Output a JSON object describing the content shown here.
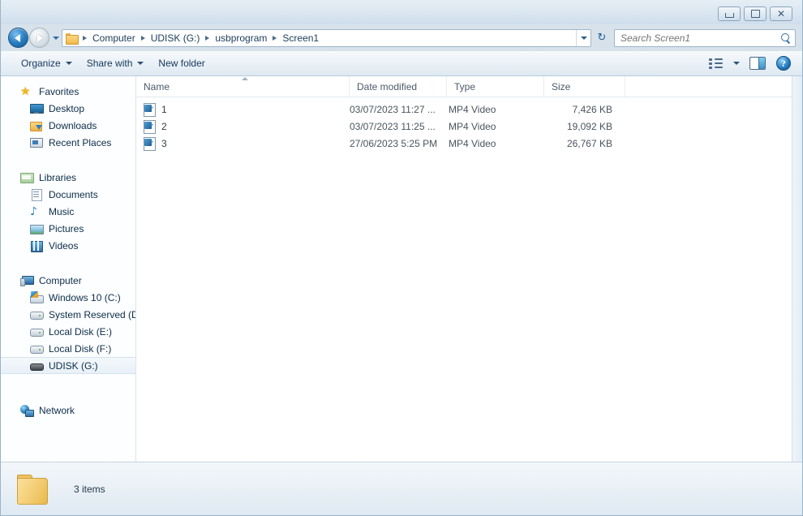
{
  "window": {
    "buttons": {
      "minimize": "Minimize",
      "restore": "Restore",
      "close": "Close"
    }
  },
  "navigation": {
    "back_label": "Back",
    "forward_label": "Forward",
    "history_label": "Recent pages",
    "refresh_label": "Refresh",
    "breadcrumbs": [
      "Computer",
      "UDISK (G:)",
      "usbprogram",
      "Screen1"
    ]
  },
  "search": {
    "placeholder": "Search Screen1",
    "value": ""
  },
  "toolbar": {
    "organize": "Organize",
    "share_with": "Share with",
    "new_folder": "New folder",
    "views_label": "Change your view",
    "preview_pane_label": "Show the preview pane",
    "help_label": "Help",
    "help_glyph": "?"
  },
  "sidebar": {
    "groups": [
      {
        "name": "Favorites",
        "icon": "star-icon",
        "items": [
          {
            "label": "Desktop",
            "icon": "desktop-icon"
          },
          {
            "label": "Downloads",
            "icon": "downloads-icon"
          },
          {
            "label": "Recent Places",
            "icon": "recent-places-icon"
          }
        ]
      },
      {
        "name": "Libraries",
        "icon": "libraries-icon",
        "items": [
          {
            "label": "Documents",
            "icon": "documents-icon"
          },
          {
            "label": "Music",
            "icon": "music-icon"
          },
          {
            "label": "Pictures",
            "icon": "pictures-icon"
          },
          {
            "label": "Videos",
            "icon": "videos-icon"
          }
        ]
      },
      {
        "name": "Computer",
        "icon": "computer-icon",
        "items": [
          {
            "label": "Windows 10 (C:)",
            "icon": "windows-drive-icon"
          },
          {
            "label": "System Reserved (D:",
            "icon": "hard-drive-icon"
          },
          {
            "label": "Local Disk (E:)",
            "icon": "hard-drive-icon"
          },
          {
            "label": "Local Disk (F:)",
            "icon": "hard-drive-icon"
          },
          {
            "label": "UDISK (G:)",
            "icon": "usb-drive-icon",
            "selected": true
          }
        ]
      },
      {
        "name": "Network",
        "icon": "network-icon",
        "items": []
      }
    ]
  },
  "filelist": {
    "columns": [
      "Name",
      "Date modified",
      "Type",
      "Size"
    ],
    "sort_column": "Name",
    "sort_direction": "ascending",
    "rows": [
      {
        "name": "1",
        "date_modified": "03/07/2023 11:27 ...",
        "type": "MP4 Video",
        "size": "7,426 KB",
        "icon": "mp4-video-icon"
      },
      {
        "name": "2",
        "date_modified": "03/07/2023 11:25 ...",
        "type": "MP4 Video",
        "size": "19,092 KB",
        "icon": "mp4-video-icon"
      },
      {
        "name": "3",
        "date_modified": "27/06/2023 5:25 PM",
        "type": "MP4 Video",
        "size": "26,767 KB",
        "icon": "mp4-video-icon"
      }
    ]
  },
  "statusbar": {
    "item_count": "3 items",
    "icon": "folder-icon"
  }
}
